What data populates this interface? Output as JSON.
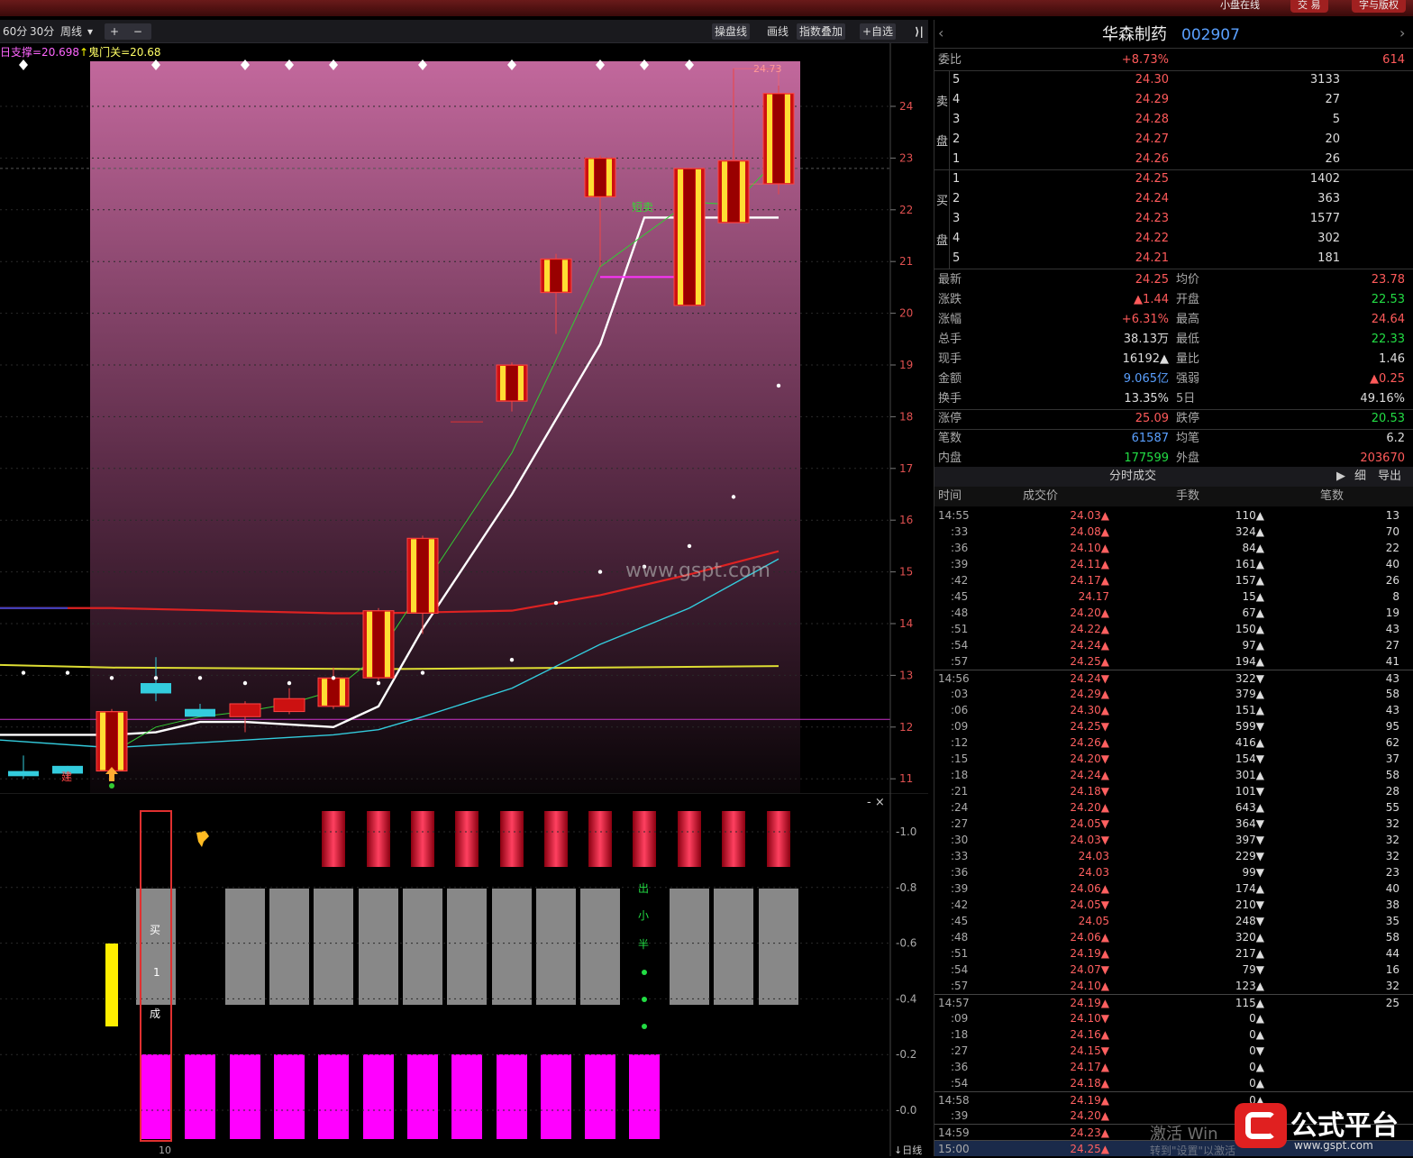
{
  "topbar": {
    "btn1": "小盘在线",
    "btn2": "交 易",
    "btn3": "字与版权"
  },
  "toolbar": {
    "periods": [
      "60分",
      "30分",
      "周线"
    ],
    "period_dropdown": "▾",
    "plus": "+",
    "minus": "−",
    "btn_pan": "操盘线",
    "btn_draw": "画线",
    "btn_index": "指数叠加",
    "btn_fav": "+自选",
    "collapse": "⟩|"
  },
  "indicator": {
    "support": "日支撑=20.698",
    "arrow": "↑",
    "gate": "鬼门关=20.68"
  },
  "chart_labels": {
    "short_sell": "短卖",
    "peak": "24.73",
    "build": "建",
    "website": "www.gspt.com",
    "sub_close": "- ×",
    "x_tick": "10",
    "sub_buy": [
      "买",
      "1",
      "成"
    ],
    "sub_out": [
      "出",
      "小",
      "半"
    ]
  },
  "chart_data": {
    "type": "candlestick",
    "y_ticks": [
      "24",
      "23",
      "22",
      "21",
      "20",
      "19",
      "18",
      "17",
      "16",
      "15",
      "14",
      "13",
      "12",
      "11"
    ],
    "sub_y_ticks": [
      "1.0",
      "0.8",
      "0.6",
      "0.4",
      "0.2",
      "0.0"
    ],
    "candles": [
      {
        "o": 11.05,
        "h": 11.45,
        "l": 11.0,
        "c": 11.15,
        "color": "cyan"
      },
      {
        "o": 11.1,
        "h": 11.25,
        "l": 11.0,
        "c": 11.25,
        "color": "cyan"
      },
      {
        "o": 11.15,
        "h": 12.35,
        "l": 11.0,
        "c": 12.3,
        "color": "red"
      },
      {
        "o": 12.65,
        "h": 13.35,
        "l": 12.5,
        "c": 12.85,
        "color": "cyan"
      },
      {
        "o": 12.2,
        "h": 12.45,
        "l": 12.2,
        "c": 12.35,
        "color": "cyan"
      },
      {
        "o": 12.2,
        "h": 12.5,
        "l": 11.9,
        "c": 12.45,
        "color": "red"
      },
      {
        "o": 12.3,
        "h": 12.75,
        "l": 12.25,
        "c": 12.55,
        "color": "red"
      },
      {
        "o": 12.4,
        "h": 13.15,
        "l": 12.35,
        "c": 12.95,
        "color": "red"
      },
      {
        "o": 12.95,
        "h": 14.3,
        "l": 12.9,
        "c": 14.25,
        "color": "red"
      },
      {
        "o": 14.2,
        "h": 15.7,
        "l": 13.8,
        "c": 15.65,
        "color": "red"
      },
      {
        "o": 18.3,
        "h": 19.05,
        "l": 18.1,
        "c": 19.0,
        "color": "red"
      },
      {
        "o": 20.4,
        "h": 21.15,
        "l": 19.6,
        "c": 21.05,
        "color": "red"
      },
      {
        "o": 22.25,
        "h": 23.05,
        "l": 20.9,
        "c": 23.0,
        "color": "red"
      },
      {
        "o": 20.15,
        "h": 22.8,
        "l": 20.15,
        "c": 22.8,
        "color": "red"
      },
      {
        "o": 21.75,
        "h": 24.73,
        "l": 21.75,
        "c": 22.95,
        "color": "red"
      },
      {
        "o": 22.5,
        "h": 24.4,
        "l": 22.3,
        "c": 24.25,
        "color": "red"
      }
    ],
    "sub_red_bars": 11,
    "sub_gray_bars": 12,
    "sub_magenta_bars": 12
  },
  "quote": {
    "name": "华森制药",
    "code": "002907",
    "weibi_label": "委比",
    "weibi_val": "+8.73%",
    "weibi_diff": "614",
    "sell_label": [
      "卖",
      "盘"
    ],
    "buy_label": [
      "买",
      "盘"
    ],
    "sell": [
      {
        "lv": "5",
        "p": "24.30",
        "v": "3133"
      },
      {
        "lv": "4",
        "p": "24.29",
        "v": "27"
      },
      {
        "lv": "3",
        "p": "24.28",
        "v": "5"
      },
      {
        "lv": "2",
        "p": "24.27",
        "v": "20"
      },
      {
        "lv": "1",
        "p": "24.26",
        "v": "26"
      }
    ],
    "buy": [
      {
        "lv": "1",
        "p": "24.25",
        "v": "1402"
      },
      {
        "lv": "2",
        "p": "24.24",
        "v": "363"
      },
      {
        "lv": "3",
        "p": "24.23",
        "v": "1577"
      },
      {
        "lv": "4",
        "p": "24.22",
        "v": "302"
      },
      {
        "lv": "5",
        "p": "24.21",
        "v": "181"
      }
    ],
    "stats": [
      {
        "l1": "最新",
        "v1": "24.25",
        "c1": "red",
        "l2": "均价",
        "v2": "23.78",
        "c2": "red"
      },
      {
        "l1": "涨跌",
        "v1": "▲1.44",
        "c1": "red",
        "l2": "开盘",
        "v2": "22.53",
        "c2": "grn"
      },
      {
        "l1": "涨幅",
        "v1": "+6.31%",
        "c1": "red",
        "l2": "最高",
        "v2": "24.64",
        "c2": "red"
      },
      {
        "l1": "总手",
        "v1": "38.13万",
        "c1": "wht",
        "l2": "最低",
        "v2": "22.33",
        "c2": "grn"
      },
      {
        "l1": "现手",
        "v1": "16192▲",
        "c1": "wht",
        "l2": "量比",
        "v2": "1.46",
        "c2": "wht"
      },
      {
        "l1": "金额",
        "v1": "9.065亿",
        "c1": "blu",
        "l2": "强弱",
        "v2": "▲0.25",
        "c2": "red"
      },
      {
        "l1": "换手",
        "v1": "13.35%",
        "c1": "wht",
        "l2": "5日",
        "v2": "49.16%",
        "c2": "wht"
      },
      {
        "l1": "涨停",
        "v1": "25.09",
        "c1": "red",
        "l2": "跌停",
        "v2": "20.53",
        "c2": "grn"
      },
      {
        "l1": "笔数",
        "v1": "61587",
        "c1": "blu",
        "l2": "均笔",
        "v2": "6.2",
        "c2": "wht"
      },
      {
        "l1": "内盘",
        "v1": "177599",
        "c1": "grn",
        "l2": "外盘",
        "v2": "203670",
        "c2": "red"
      }
    ],
    "ticks_title": "分时成交",
    "ticks_detail": "细",
    "ticks_export": "导出",
    "ticks_headers": [
      "时间",
      "成交价",
      "手数",
      "笔数"
    ],
    "ticks": [
      {
        "t": "14:55",
        "p": "24.03▲",
        "v": "110▲",
        "n": "13"
      },
      {
        "t": ":33",
        "p": "24.08▲",
        "v": "324▲",
        "n": "70"
      },
      {
        "t": ":36",
        "p": "24.10▲",
        "v": "84▲",
        "n": "22"
      },
      {
        "t": ":39",
        "p": "24.11▲",
        "v": "161▲",
        "n": "40"
      },
      {
        "t": ":42",
        "p": "24.17▲",
        "v": "157▲",
        "n": "26"
      },
      {
        "t": ":45",
        "p": "24.17",
        "v": "15▲",
        "n": "8"
      },
      {
        "t": ":48",
        "p": "24.20▲",
        "v": "67▲",
        "n": "19"
      },
      {
        "t": ":51",
        "p": "24.22▲",
        "v": "150▲",
        "n": "43"
      },
      {
        "t": ":54",
        "p": "24.24▲",
        "v": "97▲",
        "n": "27"
      },
      {
        "t": ":57",
        "p": "24.25▲",
        "v": "194▲",
        "n": "41"
      },
      {
        "t": "14:56",
        "p": "24.24▼",
        "v": "322▼",
        "n": "43"
      },
      {
        "t": ":03",
        "p": "24.29▲",
        "v": "379▲",
        "n": "58"
      },
      {
        "t": ":06",
        "p": "24.30▲",
        "v": "151▲",
        "n": "43"
      },
      {
        "t": ":09",
        "p": "24.25▼",
        "v": "599▼",
        "n": "95"
      },
      {
        "t": ":12",
        "p": "24.26▲",
        "v": "416▲",
        "n": "62"
      },
      {
        "t": ":15",
        "p": "24.20▼",
        "v": "154▼",
        "n": "37"
      },
      {
        "t": ":18",
        "p": "24.24▲",
        "v": "301▲",
        "n": "58"
      },
      {
        "t": ":21",
        "p": "24.18▼",
        "v": "101▼",
        "n": "28"
      },
      {
        "t": ":24",
        "p": "24.20▲",
        "v": "643▲",
        "n": "55"
      },
      {
        "t": ":27",
        "p": "24.05▼",
        "v": "364▼",
        "n": "32"
      },
      {
        "t": ":30",
        "p": "24.03▼",
        "v": "397▼",
        "n": "32"
      },
      {
        "t": ":33",
        "p": "24.03",
        "v": "229▼",
        "n": "32"
      },
      {
        "t": ":36",
        "p": "24.03",
        "v": "99▼",
        "n": "23"
      },
      {
        "t": ":39",
        "p": "24.06▲",
        "v": "174▲",
        "n": "40"
      },
      {
        "t": ":42",
        "p": "24.05▼",
        "v": "210▼",
        "n": "38"
      },
      {
        "t": ":45",
        "p": "24.05",
        "v": "248▼",
        "n": "35"
      },
      {
        "t": ":48",
        "p": "24.06▲",
        "v": "320▲",
        "n": "58"
      },
      {
        "t": ":51",
        "p": "24.19▲",
        "v": "217▲",
        "n": "44"
      },
      {
        "t": ":54",
        "p": "24.07▼",
        "v": "79▼",
        "n": "16"
      },
      {
        "t": ":57",
        "p": "24.10▲",
        "v": "123▲",
        "n": "32"
      },
      {
        "t": "14:57",
        "p": "24.19▲",
        "v": "115▲",
        "n": "25"
      },
      {
        "t": ":09",
        "p": "24.10▼",
        "v": "0▲",
        "n": ""
      },
      {
        "t": ":18",
        "p": "24.16▲",
        "v": "0▲",
        "n": ""
      },
      {
        "t": ":27",
        "p": "24.15▼",
        "v": "0▼",
        "n": ""
      },
      {
        "t": ":36",
        "p": "24.17▲",
        "v": "0▲",
        "n": ""
      },
      {
        "t": ":54",
        "p": "24.18▲",
        "v": "0▲",
        "n": ""
      },
      {
        "t": "14:58",
        "p": "24.19▲",
        "v": "0▲",
        "n": ""
      },
      {
        "t": ":39",
        "p": "24.20▲",
        "v": "0",
        "n": ""
      },
      {
        "t": "14:59",
        "p": "24.23▲",
        "v": "",
        "n": ""
      },
      {
        "t": "15:00",
        "p": "24.25▲",
        "v": "",
        "n": ""
      }
    ]
  },
  "watermark": {
    "text": "公式平台",
    "url": "www.gspt.com",
    "activate": "激活 Win",
    "goto": "转到\"设置\"以激活",
    "bottom_btn": "↓日线"
  }
}
